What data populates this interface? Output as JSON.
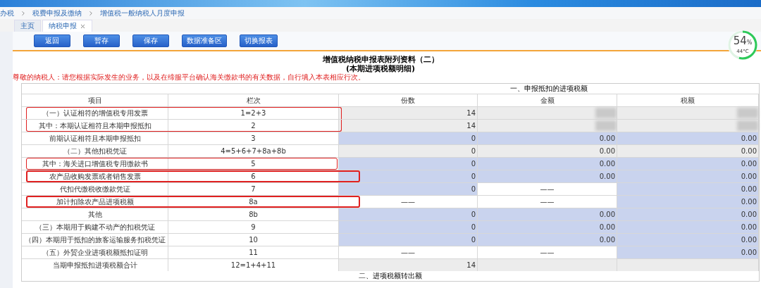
{
  "breadcrumb": [
    "办税",
    "税费申报及缴纳",
    "增值税一般纳税人月度申报"
  ],
  "tabs": [
    {
      "label": "主页",
      "selected": false,
      "closable": false
    },
    {
      "label": "纳税申报",
      "selected": true,
      "closable": true
    }
  ],
  "toolbar": [
    "返回",
    "暂存",
    "保存",
    "数据准备区",
    "切换报表"
  ],
  "gauge": {
    "reading": "54",
    "unit": "%",
    "temp": "44°C"
  },
  "title": "增值税纳税申报表附列资料（二）",
  "subtitle": "(本期进项税额明细)",
  "notice": "尊敬的纳税人：请您根据实际发生的业务，以及在缔服平台确认海关缴款书的有关数据，自行填入本表相应行次。",
  "section": "一、申报抵扣的进项税额",
  "columns": [
    "项目",
    "栏次",
    "份数",
    "金额",
    "税额"
  ],
  "rows": [
    {
      "item": "（一）认证相符的增值税专用发票",
      "code": "1=2+3",
      "kind": "frame-top",
      "cells": [
        {
          "kind": "readonly",
          "value": "14"
        },
        {
          "kind": "redacted"
        },
        {
          "kind": "redacted"
        }
      ]
    },
    {
      "item": "其中：本期认证相符且本期申报抵扣",
      "code": "2",
      "kind": "frame-bottom",
      "cells": [
        {
          "kind": "readonly",
          "value": "14"
        },
        {
          "kind": "redacted"
        },
        {
          "kind": "redacted"
        }
      ]
    },
    {
      "item": "前期认证相符且本期申报抵扣",
      "code": "3",
      "kind": "plain",
      "cells": [
        {
          "kind": "editable",
          "value": "0"
        },
        {
          "kind": "editable",
          "value": "0.00"
        },
        {
          "kind": "editable",
          "value": "0.00"
        }
      ]
    },
    {
      "item": "（二）其他扣税凭证",
      "code": "4=5+6+7+8a+8b",
      "kind": "plain",
      "cells": [
        {
          "kind": "readonly",
          "value": "0"
        },
        {
          "kind": "readonly",
          "value": "0.00"
        },
        {
          "kind": "readonly",
          "value": "0.00"
        }
      ]
    },
    {
      "item": "其中：海关进口增值税专用缴款书",
      "code": "5",
      "kind": "thin-frame",
      "cells": [
        {
          "kind": "editable",
          "value": "0"
        },
        {
          "kind": "editable",
          "value": "0.00"
        },
        {
          "kind": "editable",
          "value": "0.00"
        }
      ]
    },
    {
      "item": "农产品收购发票或者销售发票",
      "code": "6",
      "kind": "thick-frame",
      "cells": [
        {
          "kind": "editable",
          "value": "0"
        },
        {
          "kind": "editable",
          "value": "0.00"
        },
        {
          "kind": "editable",
          "value": "0.00"
        }
      ]
    },
    {
      "item": "代扣代缴税收缴款凭证",
      "code": "7",
      "kind": "plain",
      "cells": [
        {
          "kind": "editable",
          "value": "0"
        },
        {
          "kind": "blank",
          "value": "——"
        },
        {
          "kind": "editable",
          "value": "0.00"
        }
      ]
    },
    {
      "item": "加计扣除农产品进项税额",
      "code": "8a",
      "kind": "thick-frame",
      "cells": [
        {
          "kind": "blank",
          "value": "——"
        },
        {
          "kind": "blank",
          "value": "——"
        },
        {
          "kind": "editable",
          "value": "0.00"
        }
      ]
    },
    {
      "item": "其他",
      "code": "8b",
      "kind": "plain",
      "cells": [
        {
          "kind": "editable",
          "value": "0"
        },
        {
          "kind": "editable",
          "value": "0.00"
        },
        {
          "kind": "editable",
          "value": "0.00"
        }
      ]
    },
    {
      "item": "（三）本期用于购建不动产的扣税凭证",
      "code": "9",
      "kind": "plain",
      "cells": [
        {
          "kind": "editable",
          "value": "0"
        },
        {
          "kind": "editable",
          "value": "0.00"
        },
        {
          "kind": "editable",
          "value": "0.00"
        }
      ]
    },
    {
      "item": "（四）本期用于抵扣的旅客运输服务扣税凭证",
      "code": "10",
      "kind": "plain",
      "cells": [
        {
          "kind": "editable",
          "value": "0"
        },
        {
          "kind": "editable",
          "value": "0.00"
        },
        {
          "kind": "editable",
          "value": "0.00"
        }
      ]
    },
    {
      "item": "（五）外贸企业进项税额抵扣证明",
      "code": "11",
      "kind": "plain",
      "cells": [
        {
          "kind": "blank",
          "value": "——"
        },
        {
          "kind": "blank",
          "value": "——"
        },
        {
          "kind": "editable",
          "value": "0.00"
        }
      ]
    },
    {
      "item": "当期申报抵扣进项税额合计",
      "code": "12=1+4+11",
      "kind": "plain",
      "cells": [
        {
          "kind": "readonly",
          "value": "14"
        },
        {
          "kind": "readonly"
        },
        {
          "kind": "readonly"
        }
      ]
    }
  ],
  "next_section": "二、进项税额转出额"
}
